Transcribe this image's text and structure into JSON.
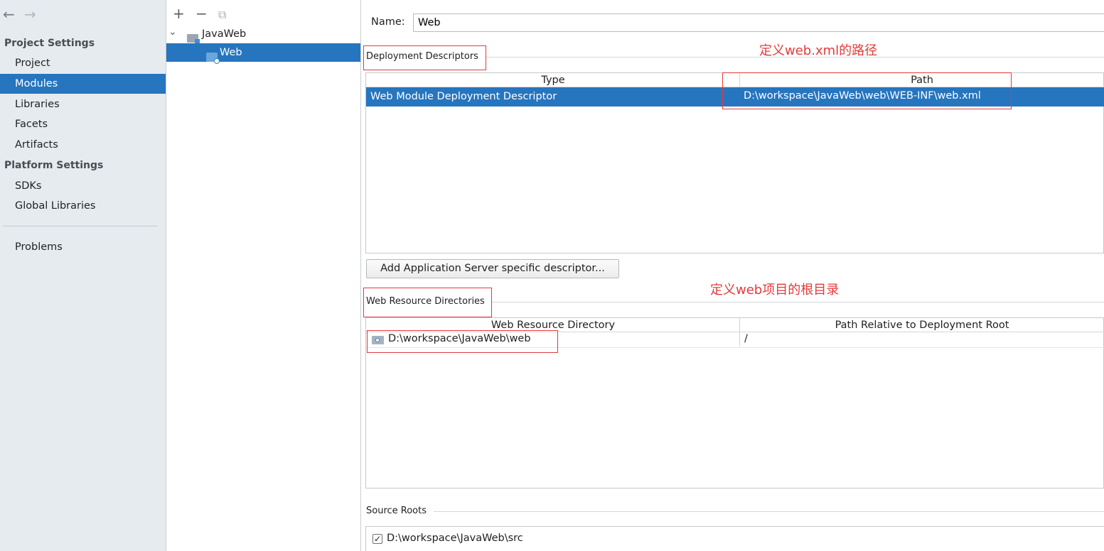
{
  "sidebar": {
    "back_glyph": "←",
    "forward_glyph": "→",
    "project_settings_title": "Project Settings",
    "project_items": [
      "Project",
      "Modules",
      "Libraries",
      "Facets",
      "Artifacts"
    ],
    "selected_item": "Modules",
    "platform_settings_title": "Platform Settings",
    "platform_items": [
      "SDKs",
      "Global Libraries"
    ],
    "problems_label": "Problems"
  },
  "tree": {
    "toolbar": {
      "add_glyph": "+",
      "remove_glyph": "−",
      "copy_glyph": "⧉"
    },
    "chevron_glyph": "⌄",
    "root_label": "JavaWeb",
    "child_label": "Web"
  },
  "content": {
    "name_label": "Name:",
    "name_value": "Web",
    "deployment_descriptors_title": "Deployment Descriptors",
    "annotation_path": "定义web.xml的路径",
    "dd_table": {
      "headers": [
        "Type",
        "Path"
      ],
      "rows": [
        {
          "type": "Web Module Deployment Descriptor",
          "path": "D:\\workspace\\JavaWeb\\web\\WEB-INF\\web.xml"
        }
      ]
    },
    "add_server_button": "Add Application Server specific descriptor...",
    "web_resource_title": "Web Resource Directories",
    "annotation_root": "定义web项目的根目录",
    "wr_table": {
      "headers": [
        "Web Resource Directory",
        "Path Relative to Deployment Root"
      ],
      "rows": [
        {
          "directory": "D:\\workspace\\JavaWeb\\web",
          "relative": "/"
        }
      ]
    },
    "source_roots_title": "Source Roots",
    "source_root_checked_glyph": "✓",
    "source_root_path": "D:\\workspace\\JavaWeb\\src"
  },
  "colors": {
    "selection": "#2675bf",
    "sidebar_bg": "#e6ebf0",
    "annotation_red": "#e53a3a"
  }
}
